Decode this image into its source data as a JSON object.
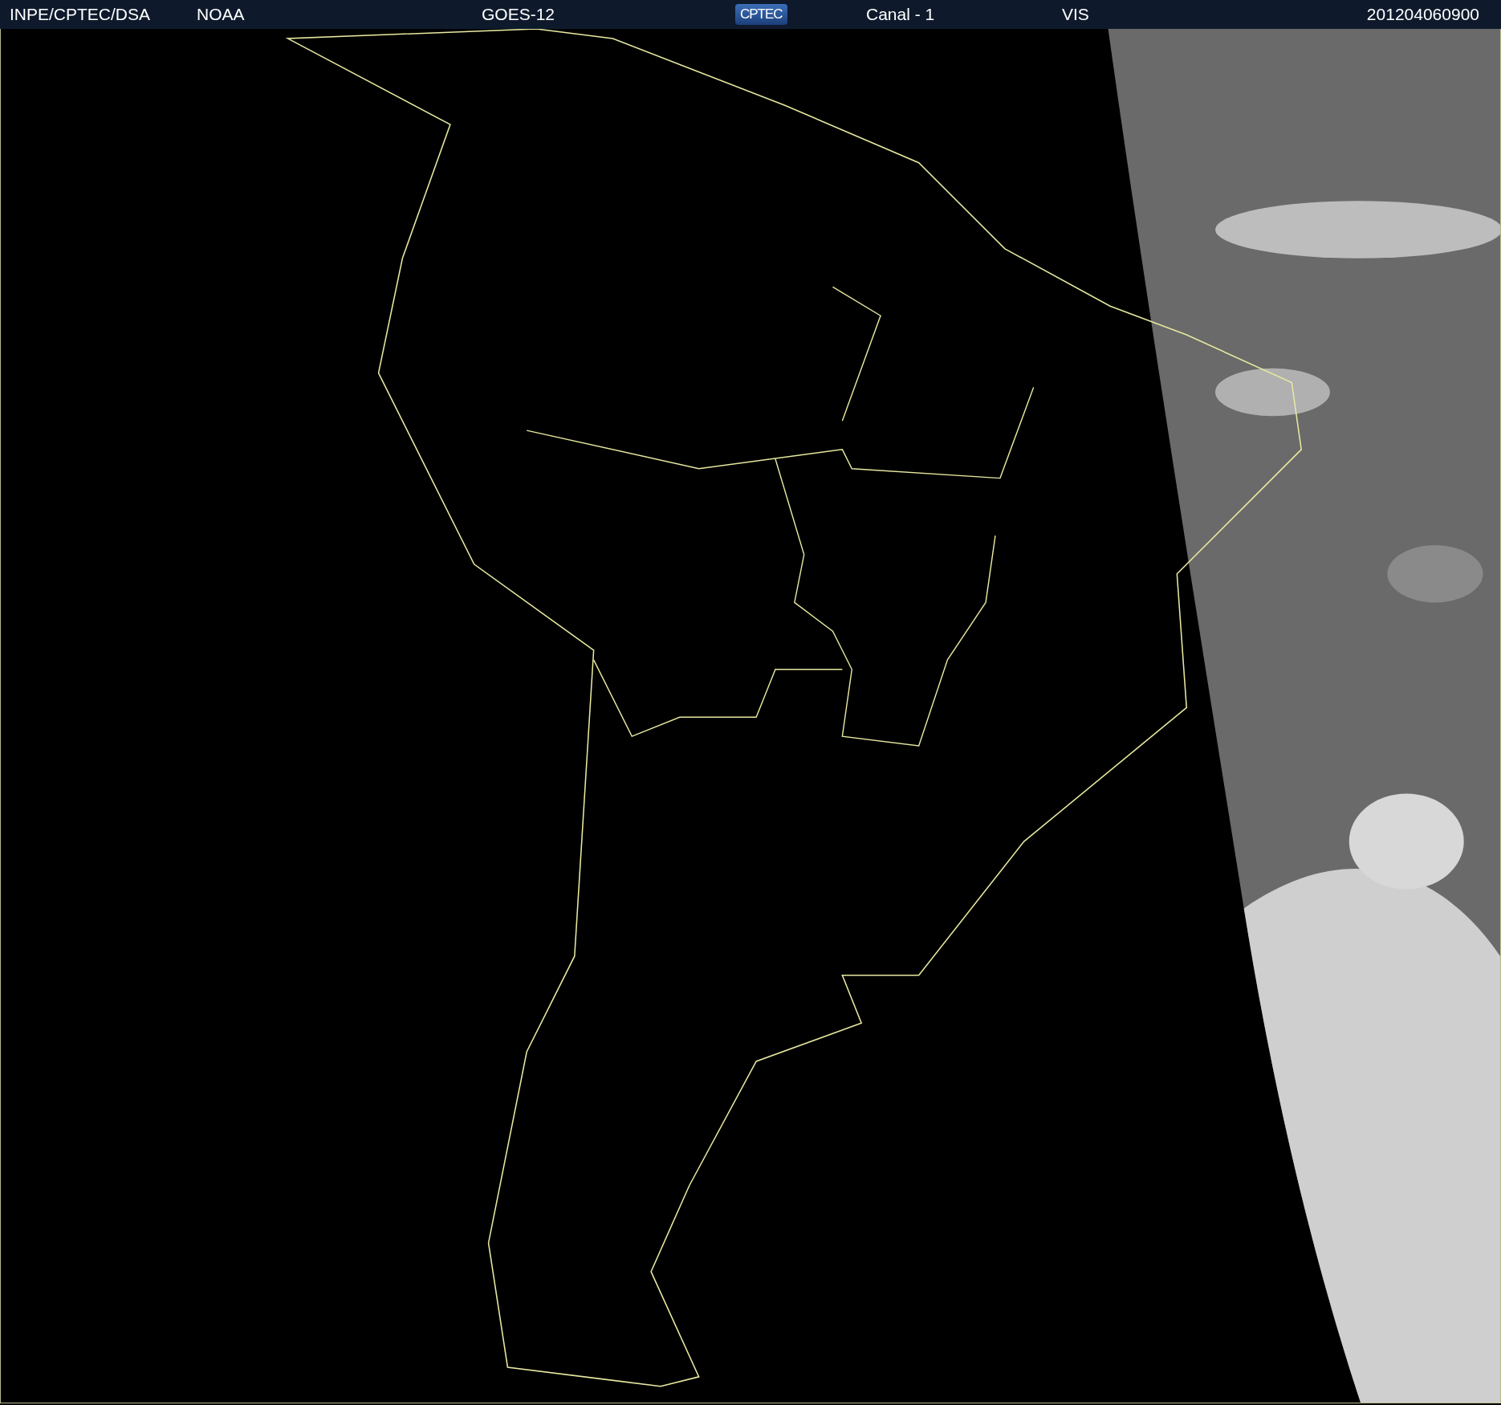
{
  "header": {
    "source": "INPE/CPTEC/DSA",
    "agency": "NOAA",
    "satellite": "GOES-12",
    "logo": "CPTEC",
    "channel": "Canal - 1",
    "band": "VIS",
    "timestamp": "201204060900"
  }
}
